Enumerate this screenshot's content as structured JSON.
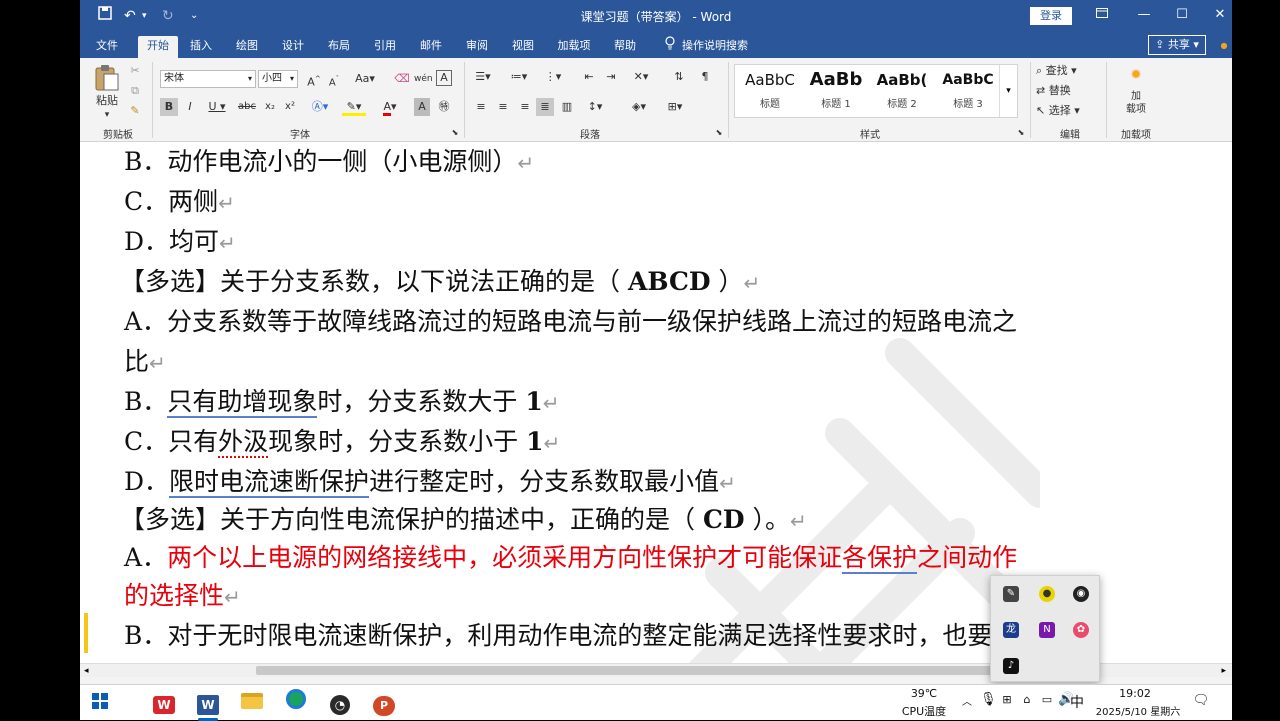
{
  "titlebar": {
    "title": "课堂习题（带答案） - Word",
    "login": "登录"
  },
  "tabs": [
    "文件",
    "开始",
    "插入",
    "绘图",
    "设计",
    "布局",
    "引用",
    "邮件",
    "审阅",
    "视图",
    "加载项",
    "帮助",
    "操作说明搜索"
  ],
  "share": "共享",
  "ribbon": {
    "paste": "粘贴",
    "clipboard": "剪贴板",
    "font_name": "宋体",
    "font_size": "小四",
    "font_group": "字体",
    "paragraph_group": "段落",
    "styles_group": "样式",
    "styles": [
      {
        "preview": "AaBbC",
        "name": "标题"
      },
      {
        "preview": "AaBb",
        "name": "标题 1"
      },
      {
        "preview": "AaBb(",
        "name": "标题 2"
      },
      {
        "preview": "AaBbC",
        "name": "标题 3"
      }
    ],
    "find": "查找",
    "replace": "替换",
    "select": "选择",
    "editing_group": "编辑",
    "addin": "加\n载项",
    "addin_group": "加载项"
  },
  "doc": {
    "l1": "B．动作电流小的一侧（小电源侧）",
    "l2": "C．两侧",
    "l3": "D．均可",
    "l4a": "【多选】关于分支系数，以下说法正确的是（ ",
    "l4b": "ABCD",
    "l4c": " ）",
    "l5": "A．分支系数等于故障线路流过的短路电流与前一级保护线路上流过的短路电流之",
    "l6": "比",
    "l7a": "B．",
    "l7b": "只有助增现象",
    "l7c": "时，分支系数大于 ",
    "l7d": "1",
    "l8a": "C．只有",
    "l8b": "外汲",
    "l8c": "现象时，分支系数小于 ",
    "l8d": "1",
    "l9a": "D．",
    "l9b": "限时电流速断保护",
    "l9c": "进行整定时，分支系数取最小值",
    "l10a": "【多选】关于方向性电流保护的描述中，正确的是（ ",
    "l10b": "CD",
    "l10c": " ）。",
    "l11a": "A．",
    "l11b": "两个以上电源的网络接线中，必须采用方向性保护才可能保证",
    "l11c": "各保护",
    "l11d": "之间动作",
    "l12": "的选择性",
    "l13": "B．对于无时限电流速断保护，利用动作电流的整定能满足选择性要求时，也要装",
    "mark": "↵"
  },
  "taskbar": {
    "temp": "39℃",
    "temp_label": "CPU温度",
    "ime": "中",
    "time": "19:02",
    "date": "2025/5/10 星期六"
  }
}
